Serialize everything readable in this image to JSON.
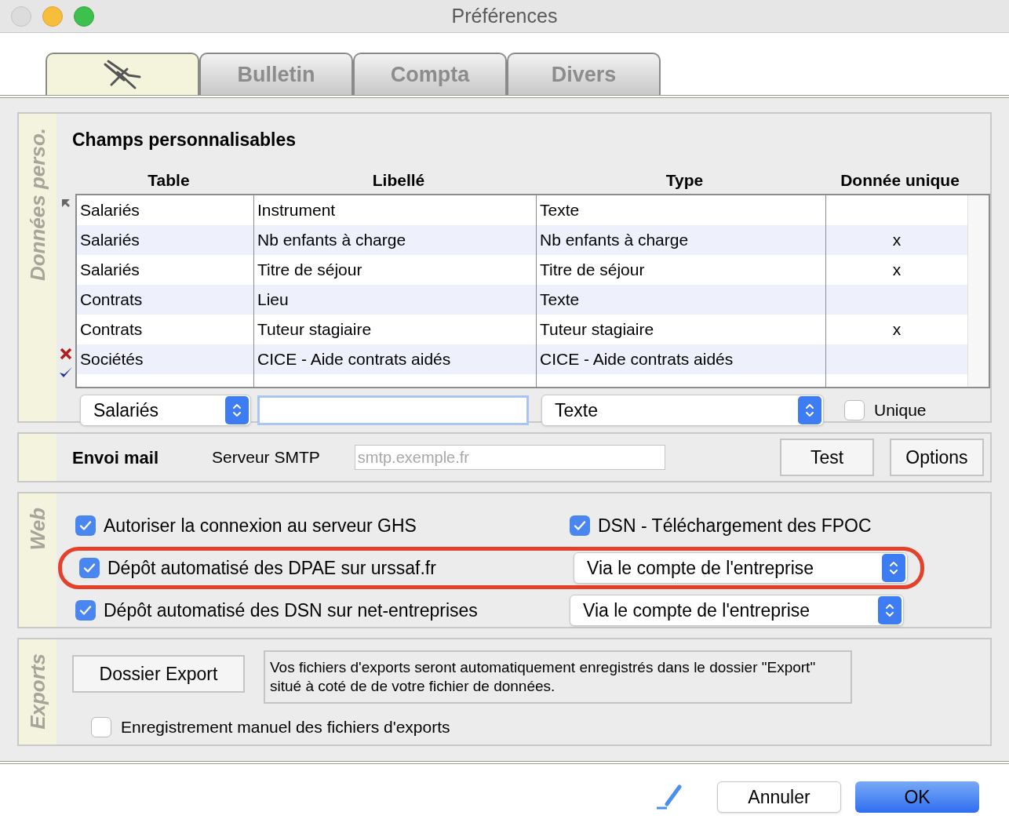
{
  "window": {
    "title": "Préférences"
  },
  "tabs": [
    {
      "kind": "icon",
      "selected": true
    },
    {
      "kind": "text",
      "label": "Bulletin",
      "selected": false
    },
    {
      "kind": "text",
      "label": "Compta",
      "selected": false
    },
    {
      "kind": "text",
      "label": "Divers",
      "selected": false
    }
  ],
  "custom_fields": {
    "section_label": "Données perso.",
    "title": "Champs personnalisables",
    "columns": [
      "Table",
      "Libellé",
      "Type",
      "Donnée unique"
    ],
    "rows": [
      {
        "cells": [
          "Salariés",
          "Instrument",
          "Texte",
          ""
        ],
        "current": true
      },
      {
        "cells": [
          "Salariés",
          "Nb enfants à charge",
          "Nb enfants à charge",
          "x"
        ],
        "current": false
      },
      {
        "cells": [
          "Salariés",
          "Titre de séjour",
          "Titre de séjour",
          "x"
        ],
        "current": false
      },
      {
        "cells": [
          "Contrats",
          "Lieu",
          "Texte",
          ""
        ],
        "current": false
      },
      {
        "cells": [
          "Contrats",
          "Tuteur stagiaire",
          "Tuteur stagiaire",
          "x"
        ],
        "current": false
      },
      {
        "cells": [
          "Sociétés",
          "CICE - Aide contrats aidés",
          "CICE - Aide contrats aidés",
          ""
        ],
        "current": false
      }
    ],
    "editor": {
      "table_select": "Salariés",
      "type_select": "Texte",
      "unique": {
        "label": "Unique",
        "checked": false
      }
    }
  },
  "mail": {
    "title": "Envoi mail",
    "smtp_label": "Serveur SMTP",
    "smtp_placeholder": "smtp.exemple.fr",
    "buttons": [
      "Test",
      "Options"
    ]
  },
  "web": {
    "section_label": "Web",
    "rows": [
      {
        "option": {
          "label": "Autoriser la connexion au serveur GHS",
          "checked": true
        },
        "right": {
          "kind": "checkbox",
          "label": "DSN - Téléchargement des FPOC",
          "checked": true
        },
        "highlighted": false
      },
      {
        "option": {
          "label": "Dépôt automatisé des DPAE sur urssaf.fr",
          "checked": true
        },
        "right": {
          "kind": "select",
          "value": "Via le compte de l'entreprise"
        },
        "highlighted": true
      },
      {
        "option": {
          "label": "Dépôt automatisé des DSN sur net-entreprises",
          "checked": true
        },
        "right": {
          "kind": "select",
          "value": "Via le compte de l'entreprise"
        },
        "highlighted": false
      }
    ]
  },
  "exports": {
    "section_label": "Exports",
    "button": "Dossier Export",
    "info": "Vos fichiers d'exports seront automatiquement enregistrés dans le dossier \"Export\" situé à coté de de votre fichier de données.",
    "manual": {
      "label": "Enregistrement manuel des fichiers d'exports",
      "checked": false
    }
  },
  "footer": {
    "buttons": [
      {
        "kind": "default",
        "label": "Annuler"
      },
      {
        "kind": "primary",
        "label": "OK"
      }
    ]
  }
}
